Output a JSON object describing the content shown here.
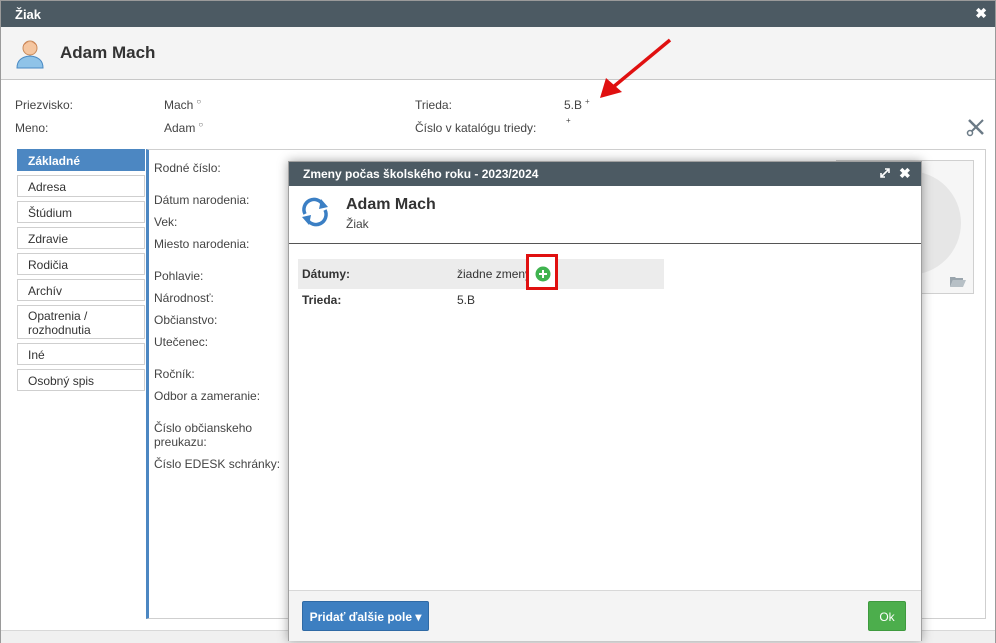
{
  "window": {
    "title": "Žiak",
    "close_glyph": "✖"
  },
  "header": {
    "name": "Adam Mach",
    "avatar_icon": "student-avatar-icon"
  },
  "info": {
    "surname_label": "Priezvisko:",
    "surname_value": "Mach",
    "surname_mark": "○",
    "firstname_label": "Meno:",
    "firstname_value": "Adam",
    "firstname_mark": "○",
    "class_label": "Trieda:",
    "class_value": "5.B",
    "class_mark": "+",
    "catalog_label": "Číslo v katalógu triedy:",
    "catalog_mark": "+"
  },
  "tabs": [
    {
      "label": "Základné",
      "active": true
    },
    {
      "label": "Adresa"
    },
    {
      "label": "Štúdium"
    },
    {
      "label": "Zdravie"
    },
    {
      "label": "Rodičia"
    },
    {
      "label": "Archív"
    },
    {
      "label": "Opatrenia / rozhodnutia"
    },
    {
      "label": "Iné"
    },
    {
      "label": "Osobný spis"
    }
  ],
  "fields": [
    "Rodné číslo:",
    "Dátum narodenia:",
    "Vek:",
    "Miesto narodenia:",
    "Pohlavie:",
    "Národnosť:",
    "Občianstvo:",
    "Utečenec:",
    "Ročník:",
    "Odbor a zameranie:",
    "Číslo občianskeho preukazu:",
    "Číslo EDESK schránky:"
  ],
  "modal": {
    "title": "Zmeny počas školského roku - 2023/2024",
    "name": "Adam Mach",
    "subtitle": "Žiak",
    "dates_label": "Dátumy:",
    "dates_value": "žiadne zmeny",
    "class_label": "Trieda:",
    "class_value": "5.B",
    "add_field_button": "Pridať ďalšie pole ▾",
    "ok_button": "Ok",
    "close_glyph": "✖"
  },
  "colors": {
    "titlebar": "#4c5a63",
    "accent": "#4c87c2",
    "ok": "#4cae4c",
    "highlight": "#e01010"
  }
}
